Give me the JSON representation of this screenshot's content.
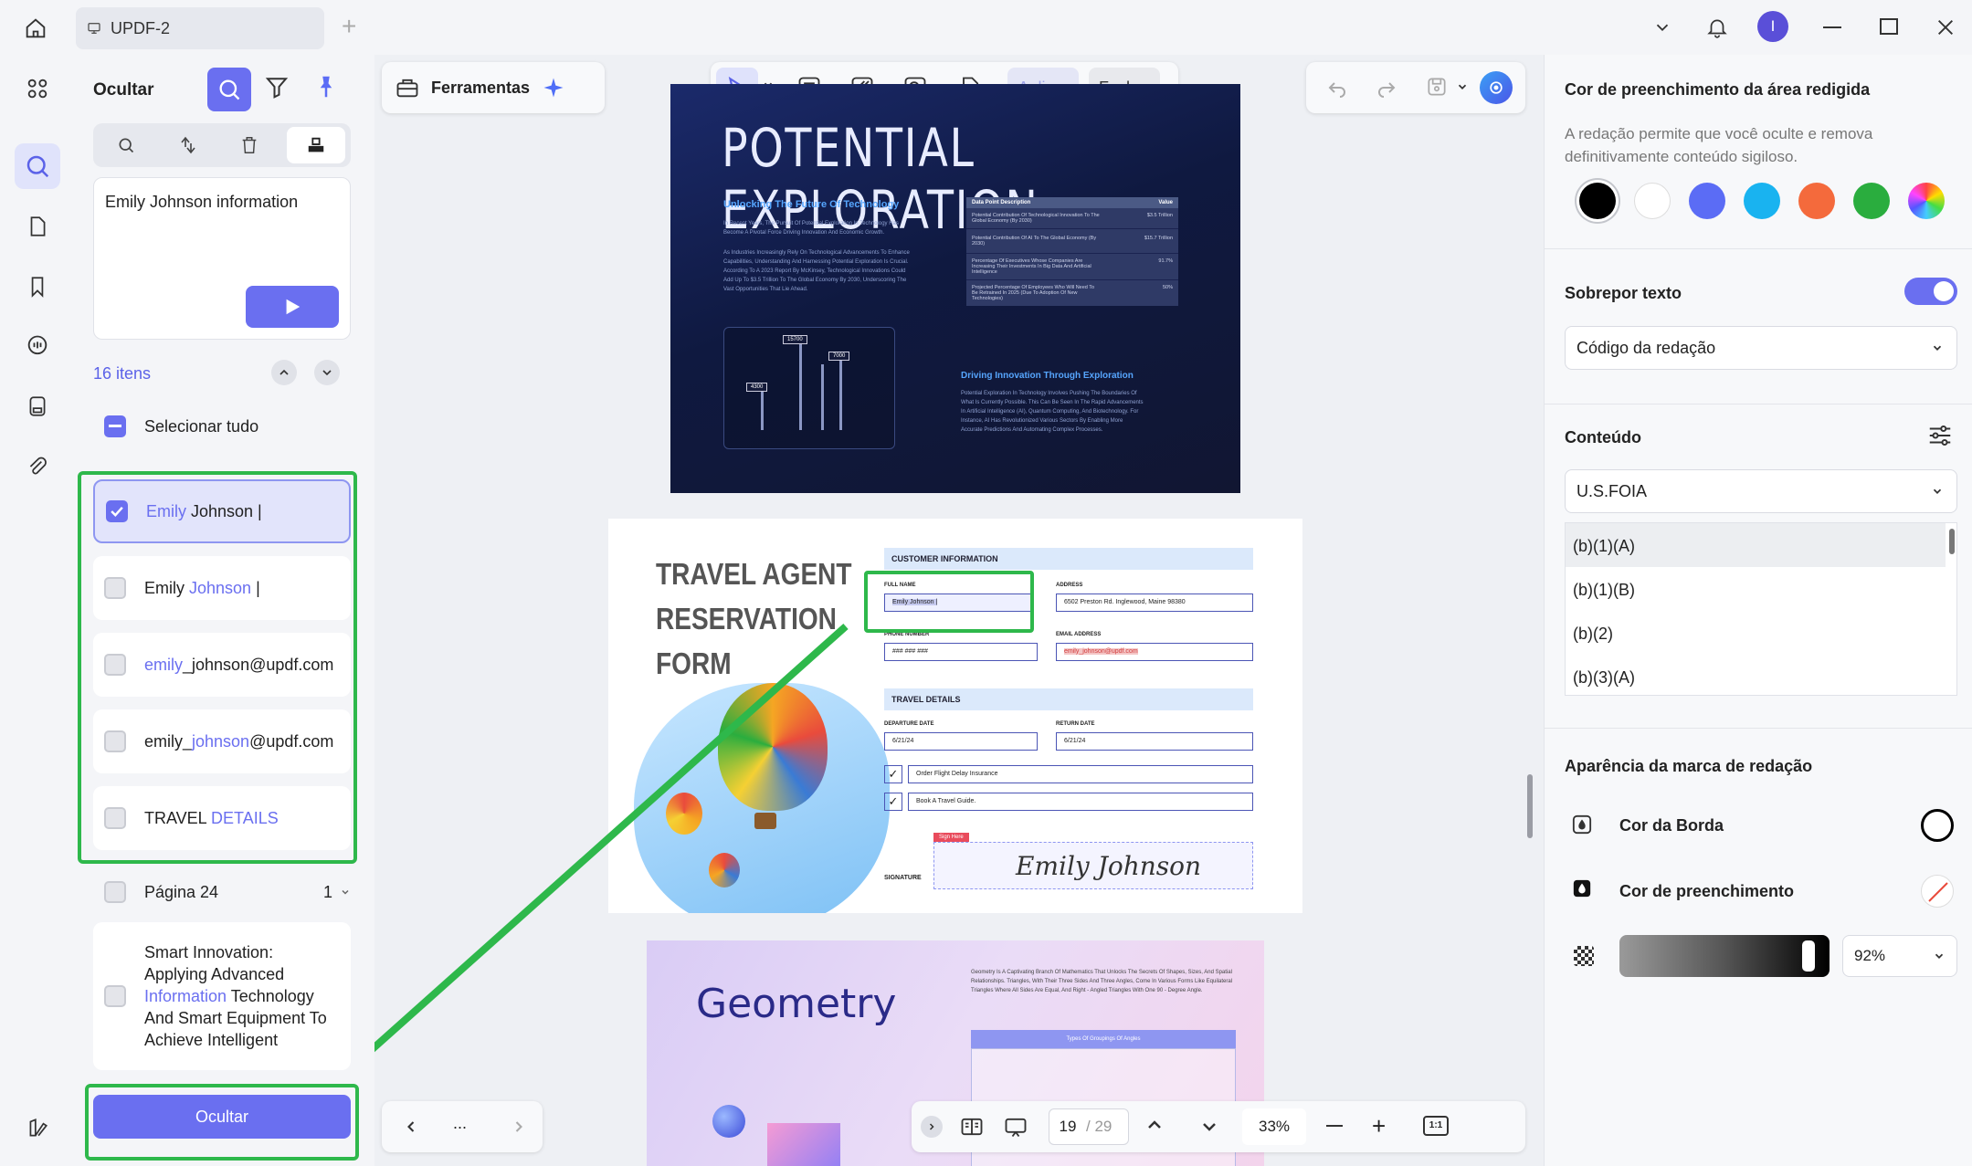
{
  "titlebar": {
    "tab_title": "UPDF-2"
  },
  "left_panel": {
    "title": "Ocultar",
    "search_text": "Emily Johnson information",
    "count_label": "16 itens",
    "select_all": "Selecionar tudo",
    "results": [
      {
        "pre": "",
        "hl": "Emily",
        "post": " Johnson |",
        "checked": true
      },
      {
        "pre": "Emily ",
        "hl": "Johnson",
        "post": " |",
        "checked": false
      },
      {
        "pre": "",
        "hl": "emily",
        "post": "_johnson@updf.com",
        "checked": false
      },
      {
        "pre": "emily_",
        "hl": "johnson",
        "post": "@updf.com",
        "checked": false
      },
      {
        "pre": "TRAVEL ",
        "hl": "DETAILS",
        "post": "",
        "checked": false
      }
    ],
    "page_group": {
      "label": "Página 24",
      "count": "1"
    },
    "smart_item": {
      "pre": "Smart Innovation: Applying Advanced ",
      "hl": "Information",
      "post": " Technology And Smart Equipment To Achieve Intelligent"
    },
    "hide_button": "Ocultar"
  },
  "toolbar": {
    "tools_label": "Ferramentas",
    "apply_label": "Aplicar",
    "close_label": "Fechar"
  },
  "page1": {
    "title": "POTENTIAL EXPLORATION",
    "subtitle": "Unlocking The Future Of Technology",
    "para1": "In Recent Years, The Pursuit Of Potential Exploration In Technology Has Become A Pivotal Force Driving Innovation And Economic Growth.",
    "para2": "As Industries Increasingly Rely On Technological Advancements To Enhance Capabilities, Understanding And Harnessing Potential Exploration Is Crucial. According To A 2023 Report By McKinsey, Technological Innovations Could Add Up To $3.5 Trillion To The Global Economy By 2030, Underscoring The Vast Opportunities That Lie Ahead.",
    "table_header": [
      "Data Point Description",
      "Value"
    ],
    "table_rows": [
      [
        "Potential Contribution Of Technological Innovation To The Global Economy (By 2030)",
        "$3.5 Trillion"
      ],
      [
        "Potential Contribution Of AI To The Global Economy (By 2030)",
        "$15.7 Trillion"
      ],
      [
        "Percentage Of Executives Whose Companies Are Increasing Their Investments In Big Data And Artificial Intelligence",
        "91.7%"
      ],
      [
        "Projected Percentage Of Employees Who Will Need To Be Retrained In 2025 (Due To Adoption Of New Technologies)",
        "50%"
      ]
    ],
    "chart_labels": [
      "15700",
      "7000",
      "4300"
    ],
    "section2_title": "Driving Innovation Through Exploration",
    "section2_text": "Potential Exploration In Technology Involves Pushing The Boundaries Of What Is Currently Possible. This Can Be Seen In The Rapid Advancements In Artificial Intelligence (AI), Quantum Computing, And Biotechnology. For Instance, AI Has Revolutionized Various Sectors By Enabling More Accurate Predictions And Automating Complex Processes."
  },
  "page2": {
    "title_lines": [
      "TRAVEL AGENT",
      "RESERVATION",
      "FORM"
    ],
    "customer_info": "CUSTOMER INFORMATION",
    "full_name_label": "FULL NAME",
    "full_name_value": "Emily Johnson |",
    "address_label": "ADDRESS",
    "address_value": "6502 Preston Rd. Inglewood, Maine 98380",
    "phone_label": "PHONE NUMBER",
    "phone_value": "### ### ###",
    "email_label": "EMAIL ADDRESS",
    "email_value": "emily_johnson@updf.com",
    "travel_details": "TRAVEL DETAILS",
    "departure_label": "DEPARTURE DATE",
    "departure_value": "6/21/24",
    "return_label": "RETURN DATE",
    "return_value": "6/21/24",
    "option1": "Order Flight Delay Insurance",
    "option2": "Book A Travel Guide.",
    "sign_here": "Sign Here",
    "signature_label": "SIGNATURE",
    "signature_value": "Emily Johnson"
  },
  "page3": {
    "title": "Geometry",
    "text": "Geometry Is A Captivating Branch Of Mathematics That Unlocks The Secrets Of Shapes, Sizes, And Spatial Relationships. Triangles, With Their Three Sides And Three Angles, Come In Various Forms Like Equilateral Triangles Where All Sides Are Equal, And Right - Angled Triangles With One 90 - Degree Angle.",
    "table_title": "Types Of Groupings Of Angles"
  },
  "bottom_bar": {
    "page_current": "19",
    "page_total": "/ 29",
    "zoom": "33%",
    "ellipsis": "...",
    "fit_label": "1:1"
  },
  "right_panel": {
    "fill_title": "Cor de preenchimento da área redigida",
    "fill_desc": "A redação permite que você oculte e remova definitivamente conteúdo sigiloso.",
    "colors": [
      "#000000",
      "#ffffff",
      "#5b6cf5",
      "#19b3f0",
      "#f46a3c",
      "#2aad3e"
    ],
    "overlay_title": "Sobrepor texto",
    "overlay_select": "Código da redação",
    "content_title": "Conteúdo",
    "content_select": "U.S.FOIA",
    "content_options": [
      "(b)(1)(A)",
      "(b)(1)(B)",
      "(b)(2)",
      "(b)(3)(A)"
    ],
    "appearance_title": "Aparência da marca de redação",
    "border_color_label": "Cor da Borda",
    "fill_color_label": "Cor de preenchimento",
    "opacity_value": "92%"
  },
  "colors": {
    "accent": "#6a6ff0",
    "annotation_green": "#2eb84b"
  }
}
